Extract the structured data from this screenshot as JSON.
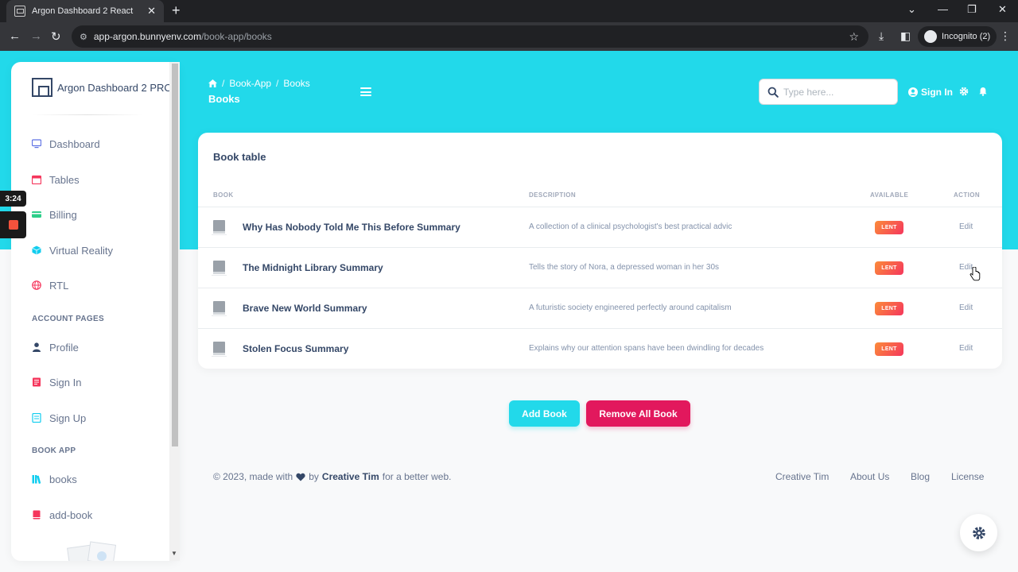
{
  "browser": {
    "tab_title": "Argon Dashboard 2 React",
    "url_host": "app-argon.bunnyenv.com",
    "url_path": "/book-app/books",
    "incognito_label": "Incognito (2)"
  },
  "recorder": {
    "time": "3:24"
  },
  "sidebar": {
    "brand": "Argon Dashboard 2 PRO",
    "items": [
      {
        "label": "Dashboard",
        "icon": "monitor-icon"
      },
      {
        "label": "Tables",
        "icon": "calendar-icon"
      },
      {
        "label": "Billing",
        "icon": "credit-card-icon"
      },
      {
        "label": "Virtual Reality",
        "icon": "cube-icon"
      },
      {
        "label": "RTL",
        "icon": "globe-icon"
      }
    ],
    "account_heading": "ACCOUNT PAGES",
    "account_items": [
      {
        "label": "Profile",
        "icon": "user-icon"
      },
      {
        "label": "Sign In",
        "icon": "document-icon"
      },
      {
        "label": "Sign Up",
        "icon": "form-icon"
      }
    ],
    "book_heading": "BOOK APP",
    "book_items": [
      {
        "label": "books",
        "icon": "library-icon"
      },
      {
        "label": "add-book",
        "icon": "book-icon"
      }
    ]
  },
  "header": {
    "breadcrumbs": [
      "Book-App",
      "Books"
    ],
    "title": "Books",
    "search_placeholder": "Type here...",
    "signin": "Sign In"
  },
  "table": {
    "title": "Book table",
    "columns": [
      "BOOK",
      "DESCRIPTION",
      "AVAILABLE",
      "ACTION"
    ],
    "rows": [
      {
        "title": "Why Has Nobody Told Me This Before Summary",
        "description": "A collection of a clinical psychologist's best practical advic",
        "status": "LENT",
        "action": "Edit"
      },
      {
        "title": "The Midnight Library Summary",
        "description": "Tells the story of Nora, a depressed woman in her 30s",
        "status": "LENT",
        "action": "Edit"
      },
      {
        "title": "Brave New World Summary",
        "description": "A futuristic society engineered perfectly around capitalism",
        "status": "LENT",
        "action": "Edit"
      },
      {
        "title": "Stolen Focus Summary",
        "description": "Explains why our attention spans have been dwindling for decades",
        "status": "LENT",
        "action": "Edit"
      }
    ]
  },
  "actions": {
    "add": "Add Book",
    "remove": "Remove All Book"
  },
  "footer": {
    "prefix": "© 2023, made with",
    "by": "by",
    "author": "Creative Tim",
    "suffix": "for a better web.",
    "links": [
      "Creative Tim",
      "About Us",
      "Blog",
      "License"
    ]
  },
  "colors": {
    "accent": "#22d9ea",
    "danger": "#e2185d",
    "badge": "#fb8c3a"
  }
}
